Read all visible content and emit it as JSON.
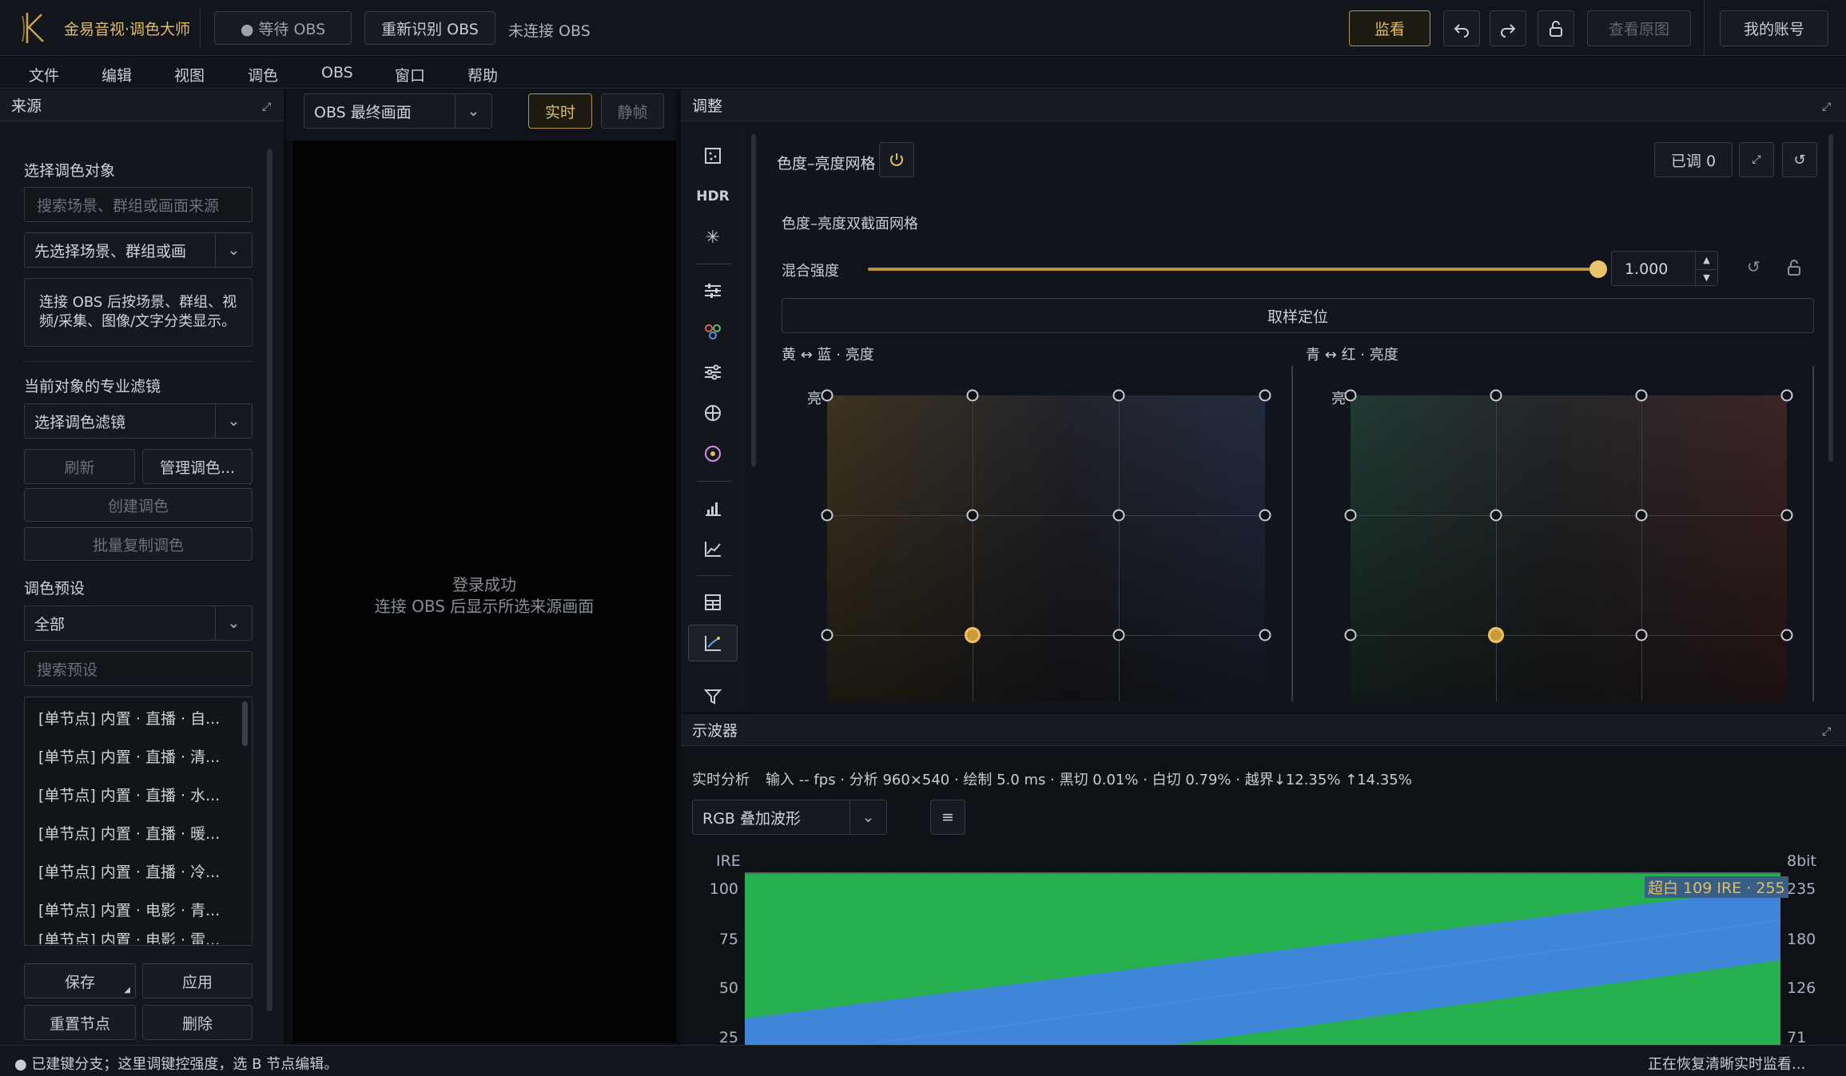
{
  "app": {
    "title": "金易音视·调色大师"
  },
  "header": {
    "status": "● 等待 OBS",
    "redetect": "重新识别 OBS",
    "conn": "未连接 OBS",
    "monitor": "监看",
    "view_original": "查看原图",
    "account": "我的账号"
  },
  "menu": [
    "文件",
    "编辑",
    "视图",
    "调色",
    "OBS",
    "窗口",
    "帮助"
  ],
  "source": {
    "title": "来源",
    "select_target_label": "选择调色对象",
    "search_placeholder": "搜索场景、群组或画面来源",
    "target_select": "先选择场景、群组或画",
    "hint": "连接 OBS 后按场景、群组、视频/采集、图像/文字分类显示。",
    "filters_label": "当前对象的专业滤镜",
    "filter_select": "选择调色滤镜",
    "refresh": "刷新",
    "manage": "管理调色...",
    "create": "创建调色",
    "batch_copy": "批量复制调色",
    "presets_label": "调色预设",
    "preset_filter": "全部",
    "preset_search_placeholder": "搜索预设",
    "presets": [
      "[单节点] 内置 · 直播 · 自...",
      "[单节点] 内置 · 直播 · 清...",
      "[单节点] 内置 · 直播 · 水...",
      "[单节点] 内置 · 直播 · 暖...",
      "[单节点] 内置 · 直播 · 冷...",
      "[单节点] 内置 · 电影 · 青...",
      "[单节点] 内置 · 电影 · 雷..."
    ],
    "save": "保存",
    "apply": "应用",
    "reset_node": "重置节点",
    "delete": "删除"
  },
  "preview": {
    "source_select": "OBS 最终画面",
    "live": "实时",
    "still": "静帧",
    "msg1": "登录成功",
    "msg2": "连接 OBS 后显示所选来源画面"
  },
  "adjust": {
    "title": "调整",
    "toolbar_hdr": "HDR",
    "section": "色度–亮度网格",
    "adjusted": "已调 0",
    "subtitle": "色度–亮度双截面网格",
    "blend_label": "混合强度",
    "blend_value": "1.000",
    "blend_level": 1.0,
    "sample": "取样定位",
    "grid_left": "黄 ↔ 蓝 · 亮度",
    "grid_right": "青 ↔ 红 · 亮度",
    "bright_left": "亮",
    "bright_right": "亮"
  },
  "scope": {
    "title": "示波器",
    "realtime": "实时分析",
    "info": "输入 -- fps · 分析 960×540 · 绘制 5.0 ms · 黑切 0.01% · 白切 0.79% · 越界↓12.35% ↑14.35%",
    "mode": "RGB 叠加波形",
    "left_unit": "IRE",
    "right_unit": "8bit",
    "ire_ticks": [
      "100",
      "75",
      "50",
      "25"
    ],
    "bit_ticks": [
      "235",
      "180",
      "126",
      "71"
    ],
    "overlay": "超白 109 IRE · 255"
  },
  "status": {
    "left": "● 已建键分支；这里调键控强度，选 B 节点编辑。",
    "right": "正在恢复清晰实时监看..."
  },
  "colors": {
    "accent": "#e3bd62",
    "waveform_green": "#27b04f",
    "waveform_blue": "#3f86d9"
  }
}
